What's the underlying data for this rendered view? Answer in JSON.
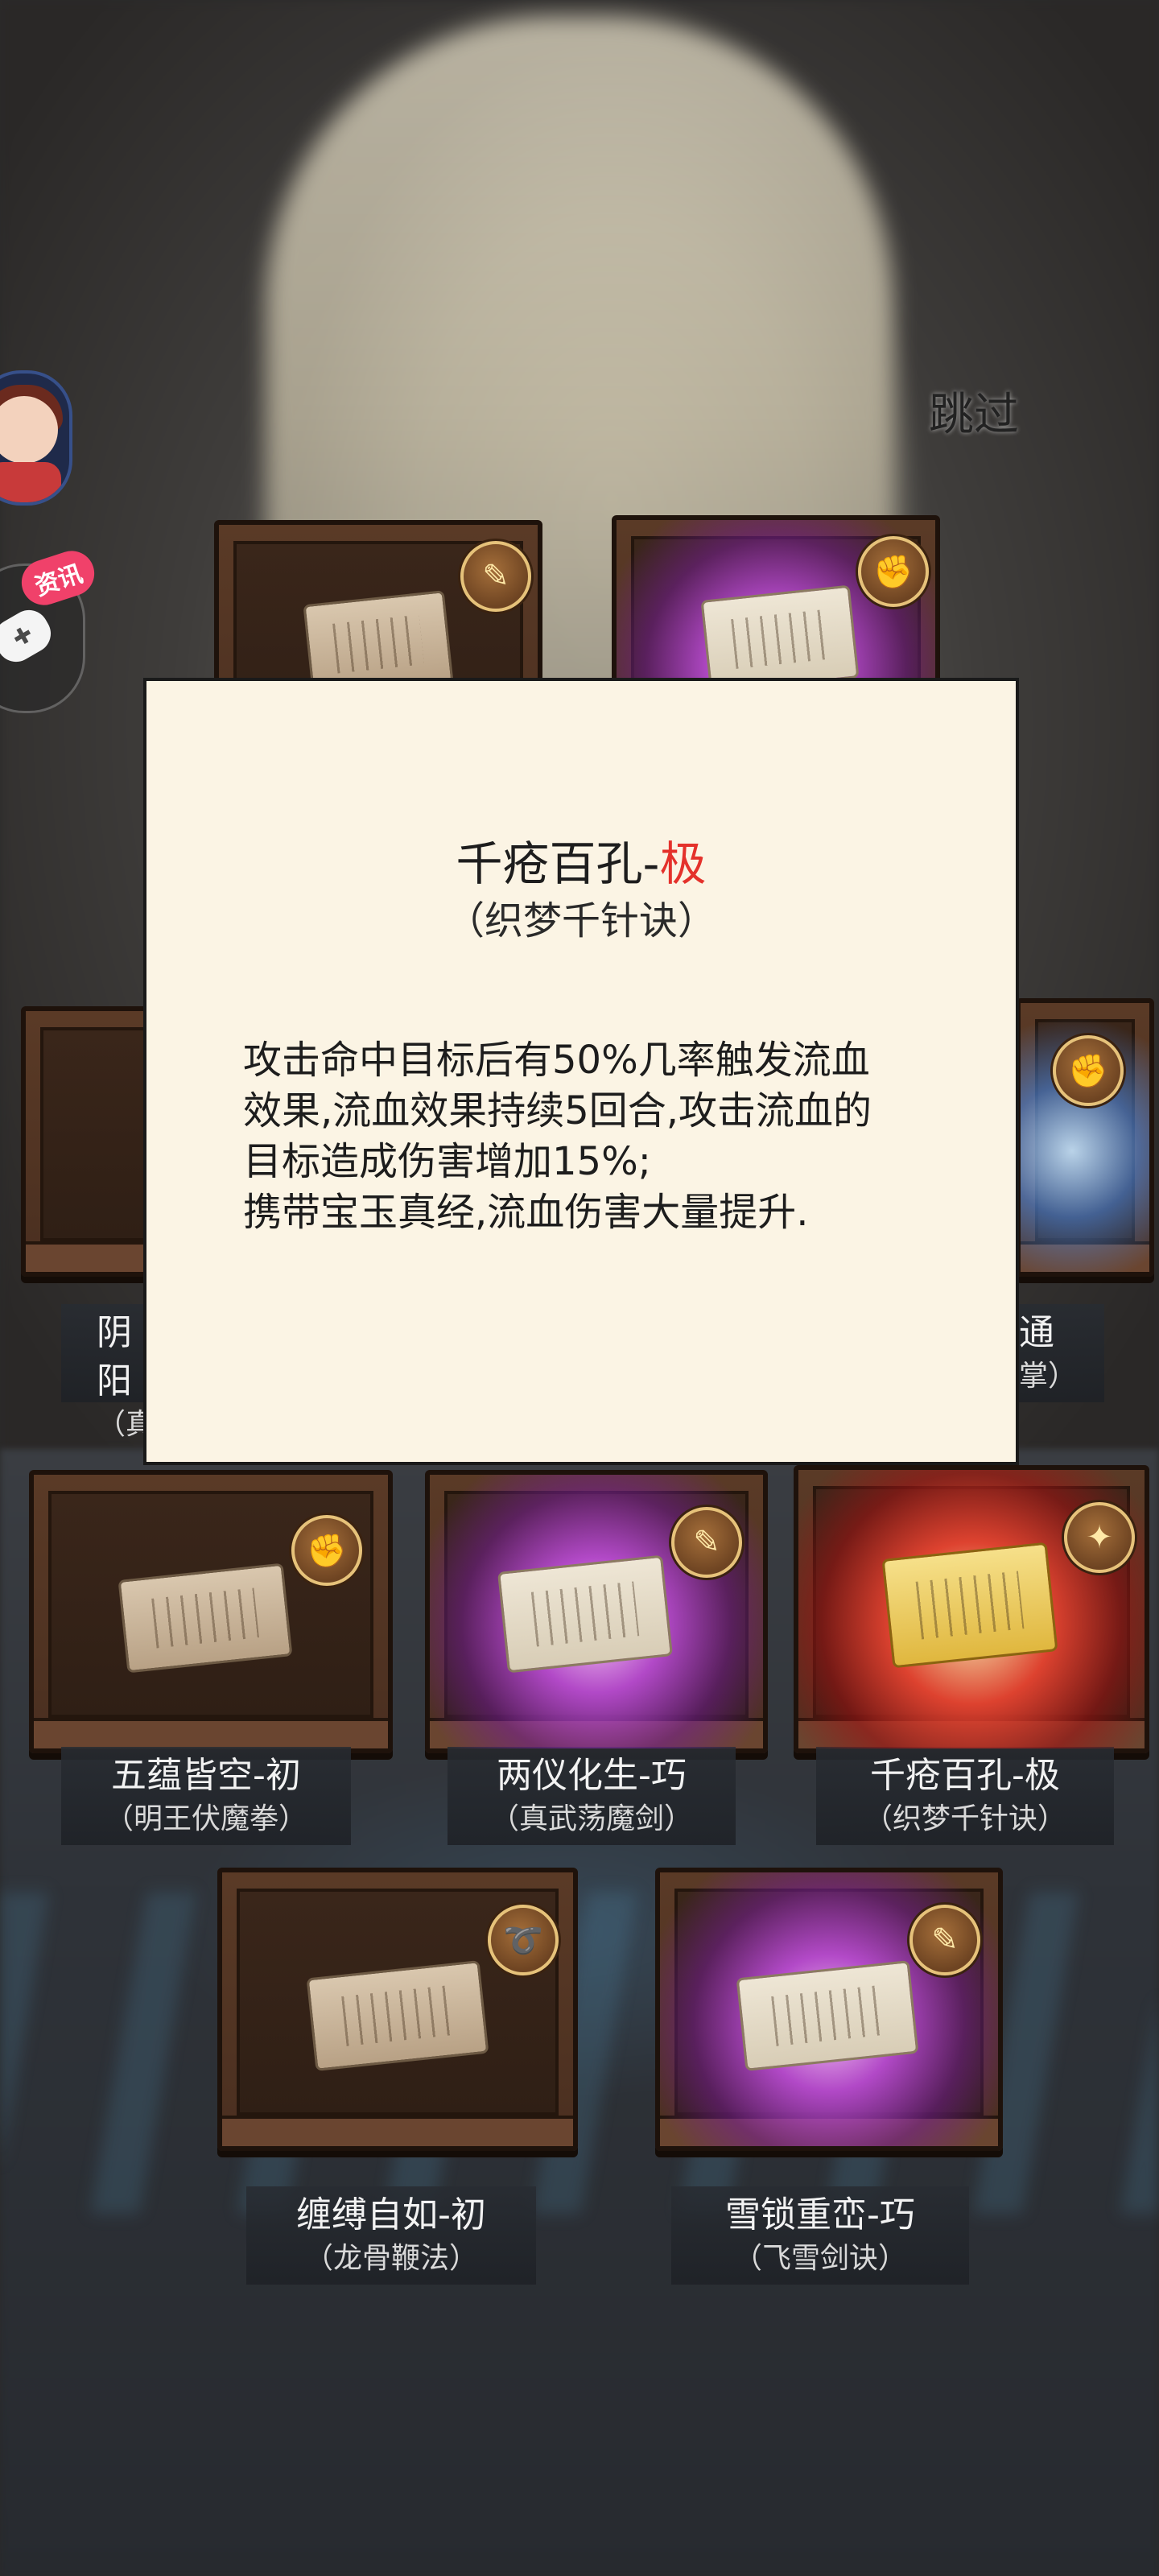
{
  "skip_label": "跳过",
  "news_badge": "资讯",
  "popup": {
    "title_name": "千疮百孔-",
    "title_grade": "极",
    "subtitle": "（织梦千针诀）",
    "description_lines": [
      "攻击命中目标后有50%几率触发流血",
      "效果,流血效果持续5回合,攻击流血的",
      "目标造成伤害增加15%;",
      "携带宝玉真经,流血伤害大量提升."
    ]
  },
  "rewards": [
    {
      "name": "五蕴皆空-初",
      "school": "（明王伏魔拳）",
      "tier": "common",
      "icon": "fist-icon"
    },
    {
      "name": "两仪化生-巧",
      "school": "（真武荡魔剑）",
      "tier": "rare",
      "icon": "sword-icon"
    },
    {
      "name": "千疮百孔-极",
      "school": "（织梦千针诀）",
      "tier": "legendary",
      "icon": "needles-icon"
    },
    {
      "name": "缠缚自如-初",
      "school": "（龙骨鞭法）",
      "tier": "common",
      "icon": "whip-icon"
    },
    {
      "name": "雪锁重峦-巧",
      "school": "（飞雪剑诀）",
      "tier": "rare",
      "icon": "sword-icon"
    }
  ],
  "partial_cards": {
    "left_name": "阴阳",
    "left_school": "（真",
    "right_name": "通",
    "right_school": "掌）"
  }
}
